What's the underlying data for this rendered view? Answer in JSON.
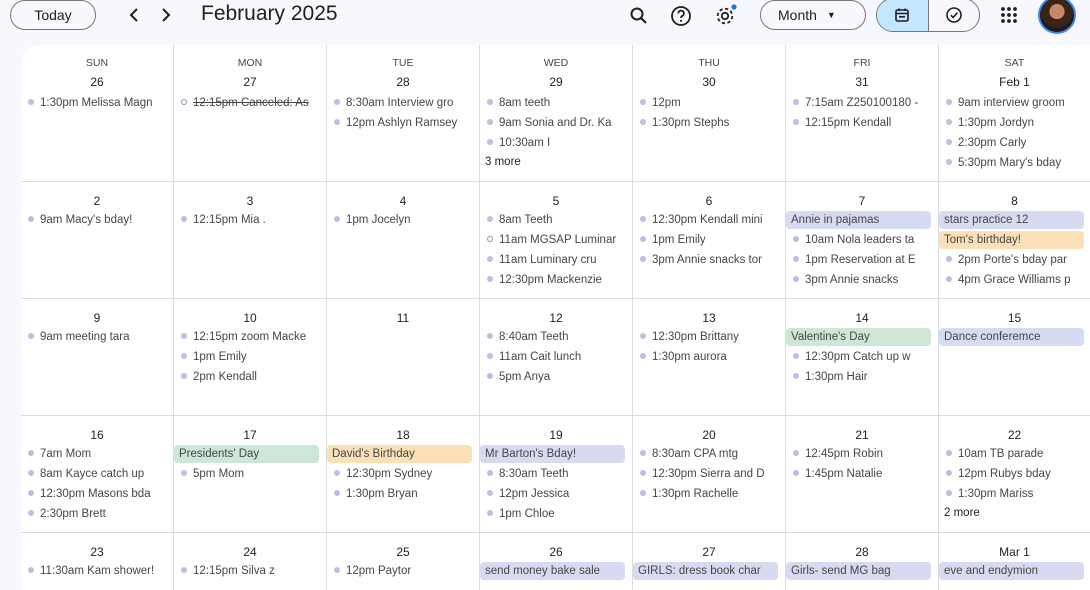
{
  "header": {
    "today_label": "Today",
    "prev_icon": "chevron-left-icon",
    "next_icon": "chevron-right-icon",
    "month_title": "February 2025",
    "view_label": "Month",
    "icons": [
      "search-icon",
      "help-icon",
      "settings-icon",
      "calendar-view-icon",
      "tasks-icon",
      "apps-grid-icon"
    ],
    "accent": "#c2e7ff"
  },
  "weekdays": [
    "SUN",
    "MON",
    "TUE",
    "WED",
    "THU",
    "FRI",
    "SAT"
  ],
  "weeks": [
    {
      "days": [
        {
          "date": "26",
          "events": [
            {
              "text": "1:30pm Melissa Magn"
            }
          ]
        },
        {
          "date": "27",
          "events": [
            {
              "text": "12:15pm Canceled: As",
              "style": "outline-strike"
            }
          ]
        },
        {
          "date": "28",
          "events": [
            {
              "text": "8:30am Interview gro"
            },
            {
              "text": "12pm Ashlyn Ramsey"
            }
          ]
        },
        {
          "date": "29",
          "events": [
            {
              "text": "8am teeth"
            },
            {
              "text": "9am Sonia and Dr. Ka"
            },
            {
              "text": "10:30am I"
            }
          ],
          "more": "3 more"
        },
        {
          "date": "30",
          "events": [
            {
              "text": "12pm"
            },
            {
              "text": "1:30pm Stephs"
            }
          ]
        },
        {
          "date": "31",
          "events": [
            {
              "text": "7:15am Z250100180 -"
            },
            {
              "text": "12:15pm Kendall"
            }
          ]
        },
        {
          "date": "Feb 1",
          "events": [
            {
              "text": "9am interview groom"
            },
            {
              "text": "1:30pm Jordyn"
            },
            {
              "text": "2:30pm Carly"
            },
            {
              "text": "5:30pm Mary's bday"
            }
          ]
        }
      ]
    },
    {
      "days": [
        {
          "date": "2",
          "events": [
            {
              "text": "9am Macy's bday!"
            }
          ]
        },
        {
          "date": "3",
          "events": [
            {
              "text": "12:15pm Mia ."
            }
          ]
        },
        {
          "date": "4",
          "events": [
            {
              "text": "1pm Jocelyn"
            }
          ]
        },
        {
          "date": "5",
          "events": [
            {
              "text": "8am Teeth"
            },
            {
              "text": "11am MGSAP Luminar",
              "style": "outline"
            },
            {
              "text": "11am Luminary cru"
            },
            {
              "text": "12:30pm Mackenzie"
            }
          ]
        },
        {
          "date": "6",
          "events": [
            {
              "text": "12:30pm Kendall mini"
            },
            {
              "text": "1pm Emily"
            },
            {
              "text": "3pm Annie snacks tor"
            }
          ]
        },
        {
          "date": "7",
          "events": [
            {
              "text": "Annie in pajamas",
              "style": "chip-blue"
            },
            {
              "text": "10am Nola leaders ta"
            },
            {
              "text": "1pm Reservation at E"
            },
            {
              "text": "3pm Annie snacks"
            }
          ]
        },
        {
          "date": "8",
          "events": [
            {
              "text": "stars practice 12",
              "style": "chip-blue"
            },
            {
              "text": "Tom's birthday!",
              "style": "chip-orange"
            },
            {
              "text": "2pm Porte's bday par"
            },
            {
              "text": "4pm Grace Williams p"
            }
          ]
        }
      ]
    },
    {
      "days": [
        {
          "date": "9",
          "events": [
            {
              "text": "9am meeting tara"
            }
          ]
        },
        {
          "date": "10",
          "events": [
            {
              "text": "12:15pm zoom Macke"
            },
            {
              "text": "1pm Emily"
            },
            {
              "text": "2pm Kendall"
            }
          ]
        },
        {
          "date": "11",
          "events": []
        },
        {
          "date": "12",
          "events": [
            {
              "text": "8:40am Teeth"
            },
            {
              "text": "11am Cait lunch"
            },
            {
              "text": "5pm Anya"
            }
          ]
        },
        {
          "date": "13",
          "events": [
            {
              "text": "12:30pm Brittany"
            },
            {
              "text": "1:30pm aurora"
            }
          ]
        },
        {
          "date": "14",
          "events": [
            {
              "text": "Valentine's Day",
              "style": "chip-green"
            },
            {
              "text": "12:30pm Catch up w"
            },
            {
              "text": "1:30pm Hair"
            }
          ]
        },
        {
          "date": "15",
          "events": [
            {
              "text": "Dance conferemce",
              "style": "chip-blue"
            }
          ]
        }
      ]
    },
    {
      "days": [
        {
          "date": "16",
          "events": [
            {
              "text": "7am Mom"
            },
            {
              "text": "8am Kayce catch up"
            },
            {
              "text": "12:30pm Masons bda"
            },
            {
              "text": "2:30pm Brett"
            }
          ]
        },
        {
          "date": "17",
          "events": [
            {
              "text": "Presidents' Day",
              "style": "chip-green"
            },
            {
              "text": "5pm Mom"
            }
          ]
        },
        {
          "date": "18",
          "events": [
            {
              "text": "David's Birthday",
              "style": "chip-orange"
            },
            {
              "text": "12:30pm Sydney"
            },
            {
              "text": "1:30pm Bryan"
            }
          ]
        },
        {
          "date": "19",
          "events": [
            {
              "text": "Mr Barton's Bday!",
              "style": "chip-blue"
            },
            {
              "text": "8:30am Teeth"
            },
            {
              "text": "12pm Jessica"
            },
            {
              "text": "1pm Chloe"
            }
          ]
        },
        {
          "date": "20",
          "events": [
            {
              "text": "8:30am CPA mtg"
            },
            {
              "text": "12:30pm Sierra and D"
            },
            {
              "text": "1:30pm Rachelle"
            }
          ]
        },
        {
          "date": "21",
          "events": [
            {
              "text": "12:45pm Robin"
            },
            {
              "text": "1:45pm Natalie"
            }
          ]
        },
        {
          "date": "22",
          "events": [
            {
              "text": "10am TB parade"
            },
            {
              "text": "12pm Rubys bday"
            },
            {
              "text": "1:30pm Mariss"
            }
          ],
          "more": "2 more"
        }
      ]
    },
    {
      "days": [
        {
          "date": "23",
          "events": [
            {
              "text": "11:30am Kam shower!"
            }
          ]
        },
        {
          "date": "24",
          "events": [
            {
              "text": "12:15pm          Silva z"
            }
          ]
        },
        {
          "date": "25",
          "events": [
            {
              "text": "12pm Paytor"
            }
          ]
        },
        {
          "date": "26",
          "events": [
            {
              "text": "send money bake sale",
              "style": "chip-blue"
            }
          ]
        },
        {
          "date": "27",
          "events": [
            {
              "text": "GIRLS: dress book char",
              "style": "chip-blue"
            }
          ]
        },
        {
          "date": "28",
          "events": [
            {
              "text": "Girls- send MG bag",
              "style": "chip-blue"
            }
          ]
        },
        {
          "date": "Mar 1",
          "events": [
            {
              "text": "eve and endymion",
              "style": "chip-blue"
            }
          ]
        }
      ]
    }
  ]
}
